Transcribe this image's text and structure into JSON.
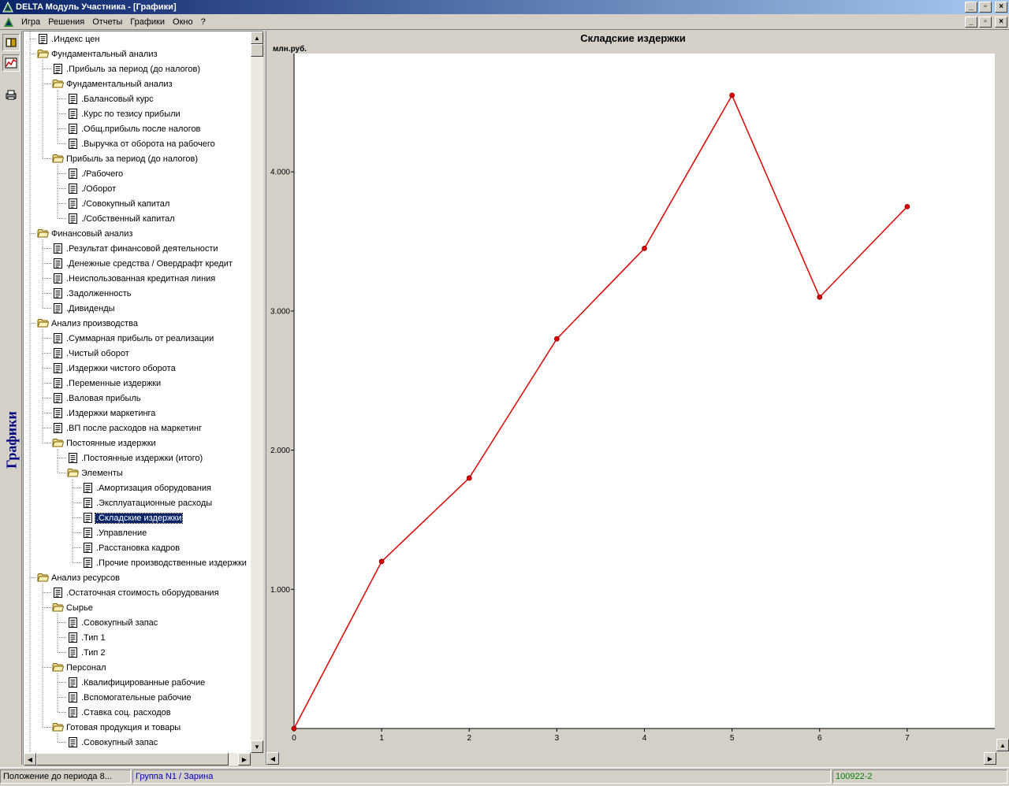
{
  "window": {
    "title": "DELTA Модуль Участника - [Графики]"
  },
  "menu": {
    "items": [
      "Игра",
      "Решения",
      "Отчеты",
      "Графики",
      "Окно",
      "?"
    ]
  },
  "sidebar": {
    "vertical_label": "Графики"
  },
  "tree": {
    "nodes": [
      {
        "label": ".Индекс цен",
        "level": 0,
        "type": "doc"
      },
      {
        "label": "Фундаментальный анализ",
        "level": 0,
        "type": "folder"
      },
      {
        "label": ".Прибыль за период (до налогов)",
        "level": 1,
        "type": "doc"
      },
      {
        "label": "Фундаментальный анализ",
        "level": 1,
        "type": "folder"
      },
      {
        "label": ".Балансовый курс",
        "level": 2,
        "type": "doc"
      },
      {
        "label": ".Курс по тезису прибыли",
        "level": 2,
        "type": "doc"
      },
      {
        "label": ".Общ.прибыль после налогов",
        "level": 2,
        "type": "doc"
      },
      {
        "label": ".Выручка от оборота на рабочего",
        "level": 2,
        "type": "doc"
      },
      {
        "label": "Прибыль за период (до налогов)",
        "level": 1,
        "type": "folder"
      },
      {
        "label": "./Рабочего",
        "level": 2,
        "type": "doc"
      },
      {
        "label": "./Оборот",
        "level": 2,
        "type": "doc"
      },
      {
        "label": "./Совокупный капитал",
        "level": 2,
        "type": "doc"
      },
      {
        "label": "./Собственный капитал",
        "level": 2,
        "type": "doc"
      },
      {
        "label": "Финансовый анализ",
        "level": 0,
        "type": "folder"
      },
      {
        "label": ".Результат финансовой деятельности",
        "level": 1,
        "type": "doc"
      },
      {
        "label": ".Денежные средства / Овердрафт кредит",
        "level": 1,
        "type": "doc"
      },
      {
        "label": ".Неиспользованная кредитная линия",
        "level": 1,
        "type": "doc"
      },
      {
        "label": ".Задолженность",
        "level": 1,
        "type": "doc"
      },
      {
        "label": ".Дивиденды",
        "level": 1,
        "type": "doc"
      },
      {
        "label": "Анализ производства",
        "level": 0,
        "type": "folder"
      },
      {
        "label": ".Суммарная прибыль от реализации",
        "level": 1,
        "type": "doc"
      },
      {
        "label": ".Чистый оборот",
        "level": 1,
        "type": "doc"
      },
      {
        "label": ".Издержки чистого оборота",
        "level": 1,
        "type": "doc"
      },
      {
        "label": ".Переменные издержки",
        "level": 1,
        "type": "doc"
      },
      {
        "label": ".Валовая прибыль",
        "level": 1,
        "type": "doc"
      },
      {
        "label": ".Издержки маркетинга",
        "level": 1,
        "type": "doc"
      },
      {
        "label": ".ВП после расходов на маркетинг",
        "level": 1,
        "type": "doc"
      },
      {
        "label": "Постоянные издержки",
        "level": 1,
        "type": "folder"
      },
      {
        "label": ".Постоянные издержки (итого)",
        "level": 2,
        "type": "doc"
      },
      {
        "label": "Элементы",
        "level": 2,
        "type": "folder"
      },
      {
        "label": ".Амортизация оборудования",
        "level": 3,
        "type": "doc"
      },
      {
        "label": ".Эксплуатационные расходы",
        "level": 3,
        "type": "doc"
      },
      {
        "label": ".Складские издержки",
        "level": 3,
        "type": "doc",
        "selected": true
      },
      {
        "label": ".Управление",
        "level": 3,
        "type": "doc"
      },
      {
        "label": ".Расстановка кадров",
        "level": 3,
        "type": "doc"
      },
      {
        "label": ".Прочие производственные издержки",
        "level": 3,
        "type": "doc"
      },
      {
        "label": "Анализ ресурсов",
        "level": 0,
        "type": "folder"
      },
      {
        "label": ".Остаточная стоимость оборудования",
        "level": 1,
        "type": "doc"
      },
      {
        "label": "Сырье",
        "level": 1,
        "type": "folder"
      },
      {
        "label": ".Совокупный запас",
        "level": 2,
        "type": "doc"
      },
      {
        "label": ".Тип 1",
        "level": 2,
        "type": "doc"
      },
      {
        "label": ".Тип 2",
        "level": 2,
        "type": "doc"
      },
      {
        "label": "Персонал",
        "level": 1,
        "type": "folder"
      },
      {
        "label": ".Квалифицированные рабочие",
        "level": 2,
        "type": "doc"
      },
      {
        "label": ".Вспомогательные рабочие",
        "level": 2,
        "type": "doc"
      },
      {
        "label": ".Ставка соц. расходов",
        "level": 2,
        "type": "doc"
      },
      {
        "label": "Готовая продукция и товары",
        "level": 1,
        "type": "folder"
      },
      {
        "label": ".Совокупный запас",
        "level": 2,
        "type": "doc"
      }
    ]
  },
  "chart_data": {
    "type": "line",
    "title": "Складские издержки",
    "ylabel": "млн.руб.",
    "x": [
      0,
      1,
      2,
      3,
      4,
      5,
      6,
      7
    ],
    "series": [
      {
        "values": [
          0.0,
          1.2,
          1.8,
          2.8,
          3.45,
          4.55,
          3.1,
          3.75
        ],
        "color": "#e00000"
      }
    ],
    "xlim": [
      0,
      8
    ],
    "ylim": [
      0,
      4.85
    ],
    "y_ticks": [
      1.0,
      2.0,
      3.0,
      4.0
    ],
    "y_tick_labels": [
      "1.000",
      "2.000",
      "3.000",
      "4.000"
    ],
    "x_tick_labels": [
      "0",
      "1",
      "2",
      "3",
      "4",
      "5",
      "6",
      "7"
    ],
    "grid": false
  },
  "status": {
    "left": "Положение до периода 8...",
    "group": "Группа N1 / Зарина",
    "code": "100922-2"
  },
  "colors": {
    "title_start": "#0a246a",
    "title_end": "#a6caf0",
    "series": "#e00000",
    "group_text": "#0000c0",
    "code_text": "#008000"
  }
}
